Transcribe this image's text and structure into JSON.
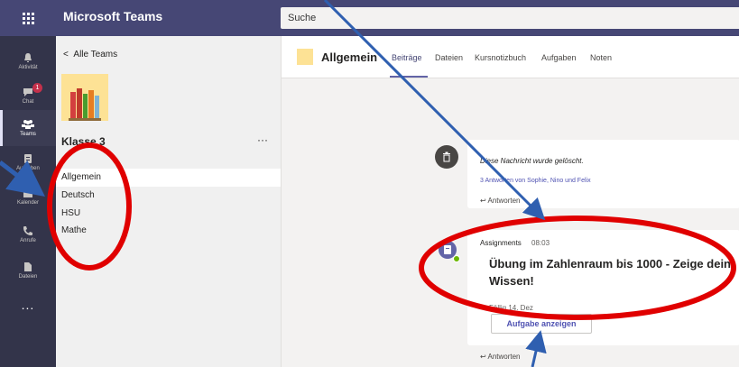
{
  "app": {
    "title": "Microsoft Teams"
  },
  "search": {
    "placeholder": "Suche"
  },
  "rail": [
    {
      "label": "Aktivität",
      "icon": "bell-icon"
    },
    {
      "label": "Chat",
      "icon": "chat-icon",
      "badge": "1"
    },
    {
      "label": "Teams",
      "icon": "teams-icon"
    },
    {
      "label": "Aufgaben",
      "icon": "assignments-icon"
    },
    {
      "label": "Kalender",
      "icon": "calendar-icon"
    },
    {
      "label": "Anrufe",
      "icon": "phone-icon"
    },
    {
      "label": "Dateien",
      "icon": "files-icon"
    }
  ],
  "rail_more": "...",
  "panel": {
    "back_label": "Alle Teams",
    "team_name": "Klasse 3",
    "more": "···",
    "channels": [
      "Allgemein",
      "Deutsch",
      "HSU",
      "Mathe"
    ]
  },
  "header": {
    "title": "Allgemein",
    "tabs": [
      "Beiträge",
      "Dateien",
      "Kursnotizbuch",
      "Aufgaben",
      "Noten"
    ]
  },
  "feed": {
    "deleted_text": "Diese Nachricht wurde gelöscht.",
    "replies": "3 Antworten von Sophie, Nino und Felix",
    "reply": "Antworten",
    "assignment": {
      "sender": "Assignments",
      "time": "08:03",
      "title": "Übung im Zahlenraum bis 1000 - Zeige dein Wissen!",
      "due": "Fällig 14. Dez",
      "button": "Aufgabe anzeigen"
    },
    "reply2": "Antworten"
  },
  "colors": {
    "topbar": "#464775",
    "rail": "#33344a",
    "accent": "#6264a7",
    "annotation_red": "#e00000",
    "annotation_arrow": "#2f5fb0"
  }
}
